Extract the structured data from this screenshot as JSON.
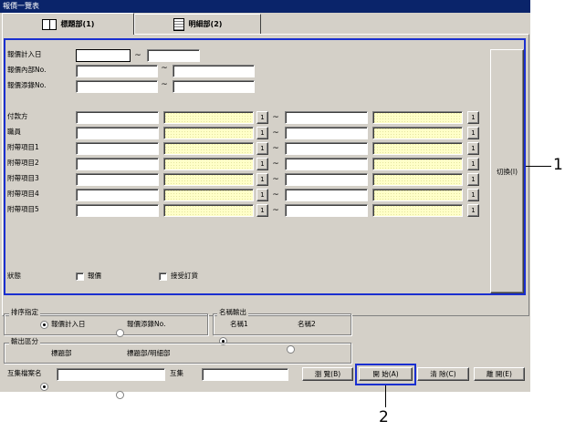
{
  "window": {
    "title": "報價一覽表"
  },
  "tabs": [
    {
      "label": "標題部(1)",
      "icon": "book-icon"
    },
    {
      "label": "明細部(2)",
      "icon": "document-icon"
    }
  ],
  "header_fields": {
    "quote_date_label": "報價計入日",
    "internal_no_label": "報價內部No.",
    "add_no_label": "報價添錄No.",
    "range_sep": "~"
  },
  "detail_rows": [
    {
      "label": "付款方"
    },
    {
      "label": "職員"
    },
    {
      "label": "附帶項目1"
    },
    {
      "label": "附帶項目2"
    },
    {
      "label": "附帶項目3"
    },
    {
      "label": "附帶項目4"
    },
    {
      "label": "附帶項目5"
    }
  ],
  "small_button_label": "1",
  "switch_button_label": "切換(I)",
  "status": {
    "label": "狀態",
    "options": [
      {
        "label": "報價",
        "checked": false
      },
      {
        "label": "接受訂貨",
        "checked": false
      }
    ]
  },
  "sort": {
    "title": "排序指定",
    "options": [
      {
        "label": "報價計入日",
        "selected": true
      },
      {
        "label": "報價添錄No.",
        "selected": false
      }
    ]
  },
  "name_output": {
    "title": "名稱輸出",
    "options": [
      {
        "label": "名稱1",
        "selected": true
      },
      {
        "label": "名稱2",
        "selected": false
      }
    ]
  },
  "output_section": {
    "title": "輸出區分",
    "options": [
      {
        "label": "標題部",
        "selected": true
      },
      {
        "label": "標題部/明細部",
        "selected": false
      }
    ]
  },
  "bottom": {
    "file_name_label": "互集檔案名",
    "collection_label": "互集",
    "browse_button": "瀏 覽(B)",
    "start_button": "開 始(A)",
    "clear_button": "清 除(C)",
    "close_button": "離 開(E)"
  },
  "callouts": {
    "one": "1",
    "two": "2"
  },
  "colors": {
    "highlight": "#1a2fd0",
    "title_bar": "#0a246a",
    "window_bg": "#d4d0c8",
    "yellow_field": "#ffffc8"
  }
}
